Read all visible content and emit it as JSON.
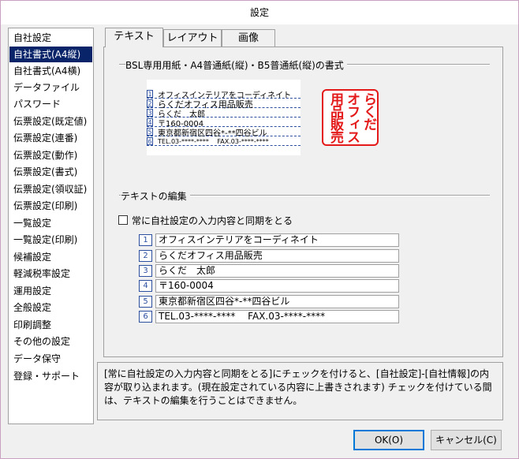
{
  "window": {
    "title": "設定"
  },
  "sidebar": {
    "items": [
      {
        "label": "自社設定"
      },
      {
        "label": "自社書式(A4縦)",
        "selected": true
      },
      {
        "label": "自社書式(A4横)"
      },
      {
        "label": "データファイル"
      },
      {
        "label": "パスワード"
      },
      {
        "label": "伝票設定(既定値)"
      },
      {
        "label": "伝票設定(連番)"
      },
      {
        "label": "伝票設定(動作)"
      },
      {
        "label": "伝票設定(書式)"
      },
      {
        "label": "伝票設定(領収証)"
      },
      {
        "label": "伝票設定(印刷)"
      },
      {
        "label": "一覧設定"
      },
      {
        "label": "一覧設定(印刷)"
      },
      {
        "label": "候補設定"
      },
      {
        "label": "軽減税率設定"
      },
      {
        "label": "運用設定"
      },
      {
        "label": "全般設定"
      },
      {
        "label": "印刷調整"
      },
      {
        "label": "その他の設定"
      },
      {
        "label": "データ保守"
      },
      {
        "label": "登録・サポート"
      }
    ]
  },
  "tabs": [
    {
      "label": "テキスト",
      "active": true
    },
    {
      "label": "レイアウト"
    },
    {
      "label": "画像"
    }
  ],
  "format_group": {
    "title": "BSL専用用紙・A4普通紙(縦)・B5普通紙(縦)の書式"
  },
  "preview": {
    "lines": [
      {
        "num": "1",
        "text": "オフィスインテリアをコーディネイト"
      },
      {
        "num": "2",
        "text": "らくだオフィス用品販売"
      },
      {
        "num": "3",
        "text": "らくだ　太郎"
      },
      {
        "num": "4",
        "text": "〒160-0004"
      },
      {
        "num": "5",
        "text": "東京都新宿区四谷*-**四谷ビル"
      },
      {
        "num": "6",
        "text": "TEL.03-****-****　 FAX.03-****-****"
      }
    ],
    "stamp_text": "らくだオフィス用品販売",
    "stamp_color": "#e41a1a"
  },
  "edit_group": {
    "title": "テキストの編集",
    "sync_checkbox_label": "常に自社設定の入力内容と同期をとる",
    "sync_checked": false,
    "fields": [
      {
        "num": "1",
        "value": "オフィスインテリアをコーディネイト"
      },
      {
        "num": "2",
        "value": "らくだオフィス用品販売"
      },
      {
        "num": "3",
        "value": "らくだ　太郎"
      },
      {
        "num": "4",
        "value": "〒160-0004"
      },
      {
        "num": "5",
        "value": "東京都新宿区四谷*-**四谷ビル"
      },
      {
        "num": "6",
        "value": "TEL.03-****-****　 FAX.03-****-****"
      }
    ]
  },
  "info_text": "[常に自社設定の入力内容と同期をとる]にチェックを付けると、[自社設定]-[自社情報]の内容が取り込まれます。(現在設定されている内容に上書きされます) チェックを付けている間は、テキストの編集を行うことはできません。",
  "buttons": {
    "ok": "OK(O)",
    "cancel": "キャンセル(C)"
  },
  "colors": {
    "selection": "#0a246a",
    "number_blue": "#2c4fa0",
    "default_button_border": "#0078d7"
  }
}
